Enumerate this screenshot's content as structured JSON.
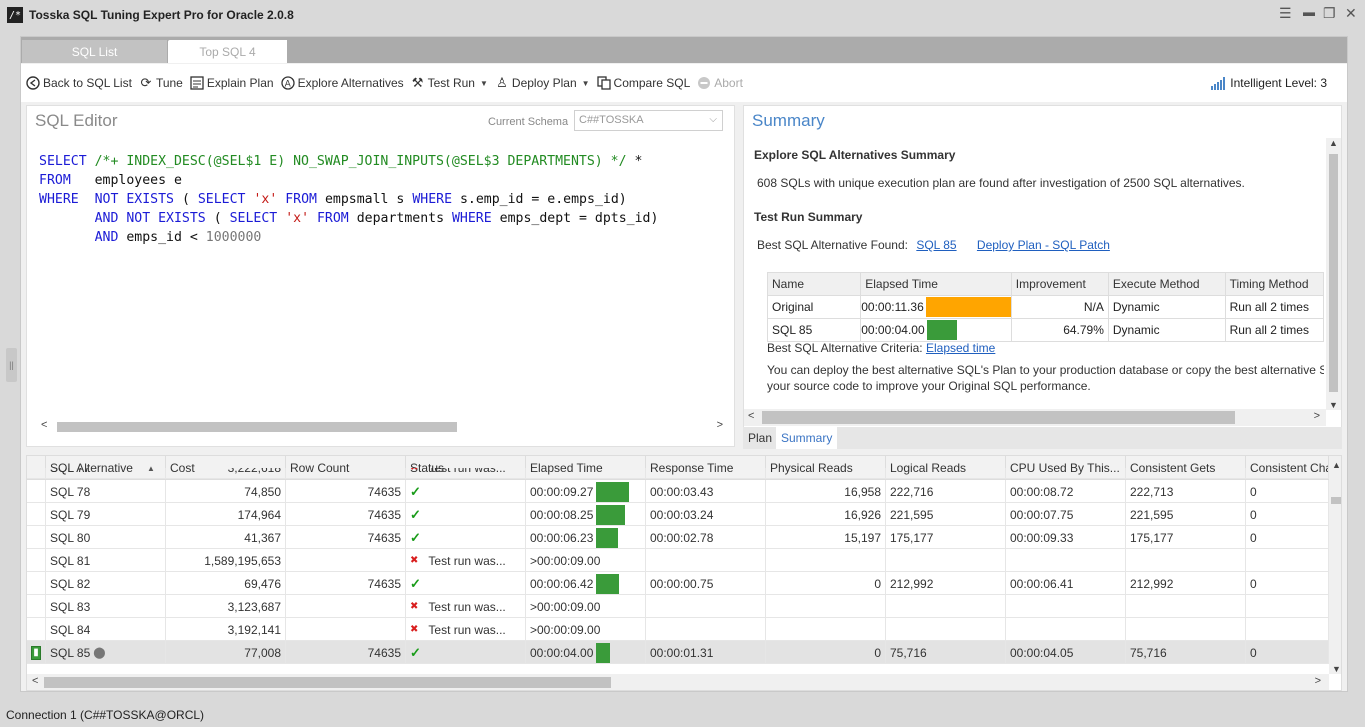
{
  "window": {
    "title": "Tosska SQL Tuning Expert Pro for Oracle 2.0.8"
  },
  "tabs": [
    {
      "label": "SQL List"
    },
    {
      "label": "Top SQL 4"
    }
  ],
  "toolbar": {
    "back": "Back to SQL List",
    "tune": "Tune",
    "explain": "Explain Plan",
    "explore": "Explore Alternatives",
    "test_run": "Test Run",
    "deploy": "Deploy Plan",
    "compare": "Compare SQL",
    "abort": "Abort",
    "intelligent": "Intelligent Level: 3"
  },
  "editor": {
    "title": "SQL Editor",
    "schema_label": "Current Schema",
    "schema_value": "C##TOSSKA"
  },
  "summary": {
    "title": "Summary",
    "explore_heading": "Explore SQL Alternatives Summary",
    "explore_text": "608 SQLs with unique execution plan are found after investigation of 2500 SQL alternatives.",
    "test_heading": "Test Run Summary",
    "best_found_label": "Best SQL Alternative Found:",
    "best_found_link": "SQL 85",
    "deploy_link": "Deploy Plan - SQL Patch",
    "table_headers": [
      "Name",
      "Elapsed Time",
      "Improvement",
      "Execute Method",
      "Timing Method"
    ],
    "table_rows": [
      {
        "name": "Original",
        "elapsed": "00:00:11.36",
        "bar_fraction": 1.0,
        "bar_color": "#ffa500",
        "improvement": "N/A",
        "method": "Dynamic",
        "timing": "Run all 2 times"
      },
      {
        "name": "SQL 85",
        "elapsed": "00:00:04.00",
        "bar_fraction": 0.35,
        "bar_color": "#3a9b3a",
        "improvement": "64.79%",
        "method": "Dynamic",
        "timing": "Run all 2 times"
      }
    ],
    "criteria_label": "Best SQL Alternative Criteria:",
    "criteria_link": "Elapsed time",
    "deploy_text_1": "You can deploy the best alternative SQL's Plan to your production database or copy the best alternative S",
    "deploy_text_2": "your source code to improve your Original SQL performance."
  },
  "subtabs": [
    {
      "label": "Plan"
    },
    {
      "label": "Summary"
    }
  ],
  "grid": {
    "headers": [
      "SQL Alternative",
      "Cost",
      "Row Count",
      "Status",
      "Elapsed Time",
      "Response Time",
      "Physical Reads",
      "Logical Reads",
      "CPU Used By This...",
      "Consistent Gets",
      "Consistent Cha"
    ],
    "partial_row": {
      "name": "SQL 77",
      "cost": "3,222,618",
      "status": "Test run was..."
    },
    "rows": [
      {
        "name": "SQL 78",
        "cost": "74,850",
        "rows": "74635",
        "status": "ok",
        "status_text": "",
        "elapsed": "00:00:09.27",
        "bar": 0.82,
        "response": "00:00:03.43",
        "physical": "16,958",
        "logical": "222,716",
        "cpu": "00:00:08.72",
        "gets": "222,713",
        "changes": "0"
      },
      {
        "name": "SQL 79",
        "cost": "174,964",
        "rows": "74635",
        "status": "ok",
        "status_text": "",
        "elapsed": "00:00:08.25",
        "bar": 0.73,
        "response": "00:00:03.24",
        "physical": "16,926",
        "logical": "221,595",
        "cpu": "00:00:07.75",
        "gets": "221,595",
        "changes": "0"
      },
      {
        "name": "SQL 80",
        "cost": "41,367",
        "rows": "74635",
        "status": "ok",
        "status_text": "",
        "elapsed": "00:00:06.23",
        "bar": 0.55,
        "response": "00:00:02.78",
        "physical": "15,197",
        "logical": "175,177",
        "cpu": "00:00:09.33",
        "gets": "175,177",
        "changes": "0"
      },
      {
        "name": "SQL 81",
        "cost": "1,589,195,653",
        "rows": "",
        "status": "fail",
        "status_text": "Test run was...",
        "elapsed": ">00:00:09.00",
        "bar": 0,
        "response": "",
        "physical": "",
        "logical": "",
        "cpu": "",
        "gets": "",
        "changes": ""
      },
      {
        "name": "SQL 82",
        "cost": "69,476",
        "rows": "74635",
        "status": "ok",
        "status_text": "",
        "elapsed": "00:00:06.42",
        "bar": 0.57,
        "response": "00:00:00.75",
        "physical": "0",
        "logical": "212,992",
        "cpu": "00:00:06.41",
        "gets": "212,992",
        "changes": "0"
      },
      {
        "name": "SQL 83",
        "cost": "3,123,687",
        "rows": "",
        "status": "fail",
        "status_text": "Test run was...",
        "elapsed": ">00:00:09.00",
        "bar": 0,
        "response": "",
        "physical": "",
        "logical": "",
        "cpu": "",
        "gets": "",
        "changes": ""
      },
      {
        "name": "SQL 84",
        "cost": "3,192,141",
        "rows": "",
        "status": "fail",
        "status_text": "Test run was...",
        "elapsed": ">00:00:09.00",
        "bar": 0,
        "response": "",
        "physical": "",
        "logical": "",
        "cpu": "",
        "gets": "",
        "changes": ""
      },
      {
        "name": "SQL 85",
        "cost": "77,008",
        "rows": "74635",
        "status": "ok",
        "status_text": "",
        "elapsed": "00:00:04.00",
        "bar": 0.35,
        "response": "00:00:01.31",
        "physical": "0",
        "logical": "75,716",
        "cpu": "00:00:04.05",
        "gets": "75,716",
        "changes": "0",
        "selected": true
      }
    ]
  },
  "statusbar": {
    "text": "Connection 1 (C##TOSSKA@ORCL)"
  }
}
